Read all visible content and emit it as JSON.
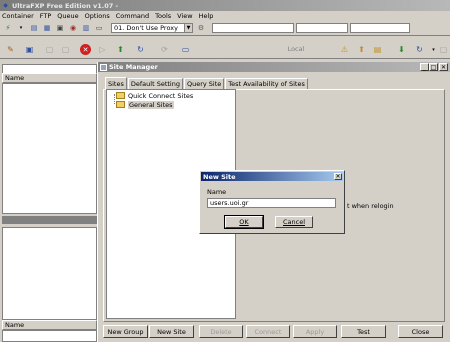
{
  "app": {
    "title": "UltraFXP Free Edition v1.07 -"
  },
  "menu": [
    "Container",
    "FTP",
    "Queue",
    "Options",
    "Command",
    "Tools",
    "View",
    "Help"
  ],
  "toolbar": {
    "proxy_value": "01. Don't Use Proxy"
  },
  "toolbar2": {
    "local_label": "Local"
  },
  "left_panel": {
    "header1": "Name",
    "header2": "Name"
  },
  "site_manager": {
    "title": "Site Manager",
    "tabs": [
      "Sites",
      "Default Setting",
      "Query Site",
      "Test Availability of Sites"
    ],
    "tree": [
      "Quick Connect Sites",
      "General Sites"
    ],
    "relogin_text": "t when relogin",
    "buttons": [
      "New Group",
      "New Site",
      "Delete",
      "Connect",
      "Apply",
      "Test",
      "Close"
    ]
  },
  "dialog": {
    "title": "New Site",
    "label": "Name",
    "value": "users.uoi.gr",
    "ok": "OK",
    "cancel": "Cancel"
  }
}
